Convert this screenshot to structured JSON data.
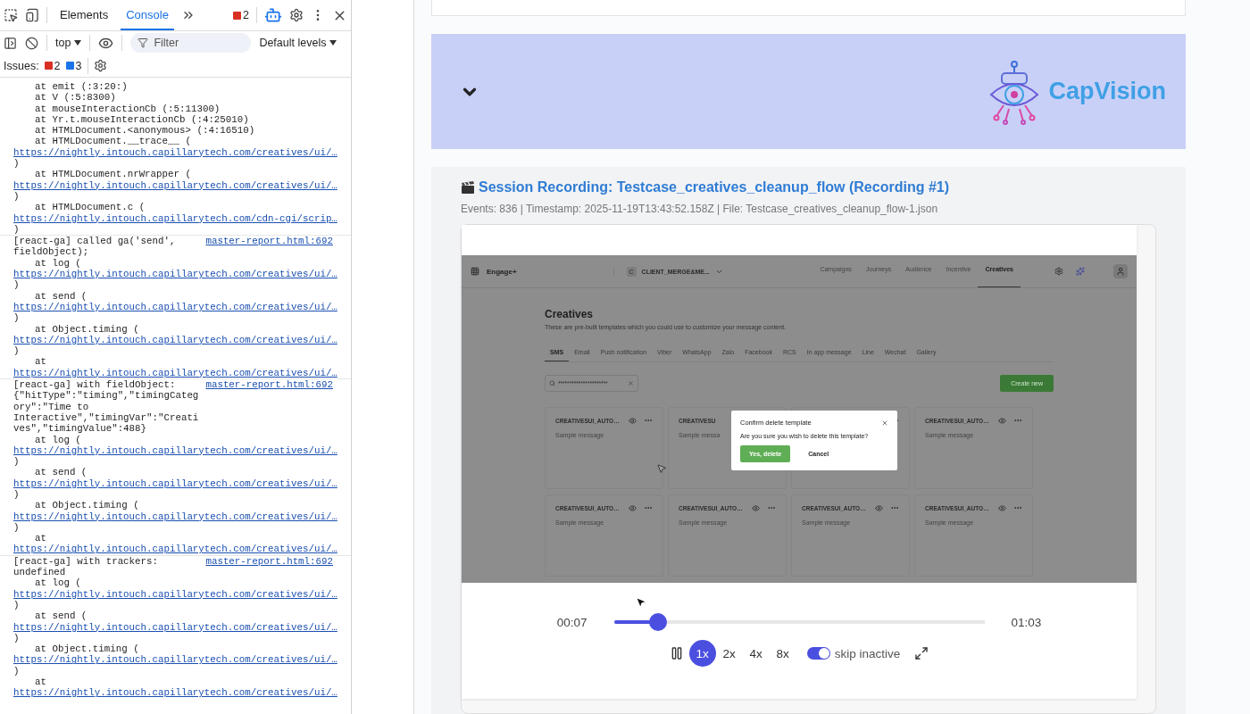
{
  "devtools": {
    "tabs": [
      {
        "label": "Elements",
        "selected": false
      },
      {
        "label": "Console",
        "selected": true
      }
    ],
    "error_count": "2",
    "context": "top",
    "filter_placeholder": "Filter",
    "levels": "Default levels",
    "issues_label": "Issues:",
    "issues": [
      {
        "kind": "error",
        "count": "2"
      },
      {
        "kind": "info",
        "count": "3"
      }
    ],
    "log": [
      {
        "lines": [
          {
            "kind": "frame",
            "text": "at emit (:3:20:)"
          },
          {
            "kind": "frame",
            "text": "at V (:5:8300)"
          },
          {
            "kind": "frame",
            "text": "at mouseInteractionCb (:5:11300)"
          },
          {
            "kind": "frame",
            "text": "at Yr.t.mouseInteractionCb (:4:25010)"
          },
          {
            "kind": "frame",
            "text": "at HTMLDocument.<anonymous> (:4:16510)"
          },
          {
            "kind": "frame",
            "text": "at HTMLDocument.__trace__ ("
          },
          {
            "kind": "url",
            "text": "https://nightly.intouch.capillarytech.com/creatives/ui/…"
          },
          {
            "kind": "close",
            "text": ")"
          },
          {
            "kind": "frame",
            "text": "at HTMLDocument.nrWrapper ("
          },
          {
            "kind": "url",
            "text": "https://nightly.intouch.capillarytech.com/creatives/ui/…"
          },
          {
            "kind": "close",
            "text": ")"
          },
          {
            "kind": "frame",
            "text": "at HTMLDocument.c ("
          },
          {
            "kind": "url",
            "text": "https://nightly.intouch.capillarytech.com/cdn-cgi/scrip…"
          },
          {
            "kind": "close",
            "text": ")"
          }
        ]
      },
      {
        "message": "[react-ga] called ga('send', fieldObject);",
        "source": "master-report.html:692",
        "lines": [
          {
            "kind": "frame",
            "text": "at log ("
          },
          {
            "kind": "url",
            "text": "https://nightly.intouch.capillarytech.com/creatives/ui/…"
          },
          {
            "kind": "close",
            "text": ")"
          },
          {
            "kind": "frame",
            "text": "at send ("
          },
          {
            "kind": "url",
            "text": "https://nightly.intouch.capillarytech.com/creatives/ui/…"
          },
          {
            "kind": "close",
            "text": ")"
          },
          {
            "kind": "frame",
            "text": "at Object.timing ("
          },
          {
            "kind": "url",
            "text": "https://nightly.intouch.capillarytech.com/creatives/ui/…"
          },
          {
            "kind": "close",
            "text": ")"
          },
          {
            "kind": "frame",
            "text": "at"
          },
          {
            "kind": "url",
            "text": "https://nightly.intouch.capillarytech.com/creatives/ui/…"
          }
        ]
      },
      {
        "message": "[react-ga] with fieldObject: {\"hitType\":\"timing\",\"timingCategory\":\"Time to Interactive\",\"timingVar\":\"Creatives\",\"timingValue\":488}",
        "source": "master-report.html:692",
        "lines": [
          {
            "kind": "frame",
            "text": "at log ("
          },
          {
            "kind": "url",
            "text": "https://nightly.intouch.capillarytech.com/creatives/ui/…"
          },
          {
            "kind": "close",
            "text": ")"
          },
          {
            "kind": "frame",
            "text": "at send ("
          },
          {
            "kind": "url",
            "text": "https://nightly.intouch.capillarytech.com/creatives/ui/…"
          },
          {
            "kind": "close",
            "text": ")"
          },
          {
            "kind": "frame",
            "text": "at Object.timing ("
          },
          {
            "kind": "url",
            "text": "https://nightly.intouch.capillarytech.com/creatives/ui/…"
          },
          {
            "kind": "close",
            "text": ")"
          },
          {
            "kind": "frame",
            "text": "at"
          },
          {
            "kind": "url",
            "text": "https://nightly.intouch.capillarytech.com/creatives/ui/…"
          }
        ]
      },
      {
        "message": "[react-ga] with trackers: undefined",
        "source": "master-report.html:692",
        "lines": [
          {
            "kind": "frame",
            "text": "at log ("
          },
          {
            "kind": "url",
            "text": "https://nightly.intouch.capillarytech.com/creatives/ui/…"
          },
          {
            "kind": "close",
            "text": ")"
          },
          {
            "kind": "frame",
            "text": "at send ("
          },
          {
            "kind": "url",
            "text": "https://nightly.intouch.capillarytech.com/creatives/ui/…"
          },
          {
            "kind": "close",
            "text": ")"
          },
          {
            "kind": "frame",
            "text": "at Object.timing ("
          },
          {
            "kind": "url",
            "text": "https://nightly.intouch.capillarytech.com/creatives/ui/…"
          },
          {
            "kind": "close",
            "text": ")"
          },
          {
            "kind": "frame",
            "text": "at"
          },
          {
            "kind": "url",
            "text": "https://nightly.intouch.capillarytech.com/creatives/ui/…"
          }
        ]
      }
    ]
  },
  "banner": {
    "logo_text": "CapVision"
  },
  "recording": {
    "title": "Session Recording: Testcase_creatives_cleanup_flow (Recording #1)",
    "meta": "Events: 836 | Timestamp: 2025-11-19T13:43:52.158Z | File: Testcase_creatives_cleanup_flow-1.json",
    "app": {
      "brand": "Engage+",
      "org_initial": "C",
      "org": "CLIENT_MERGE&ME...",
      "nav": [
        {
          "label": "Campaigns",
          "selected": false
        },
        {
          "label": "Journeys",
          "selected": false
        },
        {
          "label": "Audience",
          "selected": false
        },
        {
          "label": "Incentive",
          "selected": false
        },
        {
          "label": "Creatives",
          "selected": true
        }
      ],
      "page_title": "Creatives",
      "page_subtitle": "These are pre-built templates which you could use to customize your message content.",
      "channels": [
        {
          "label": "SMS",
          "selected": true
        },
        {
          "label": "Email",
          "selected": false
        },
        {
          "label": "Push notification",
          "selected": false
        },
        {
          "label": "Viber",
          "selected": false
        },
        {
          "label": "WhatsApp",
          "selected": false
        },
        {
          "label": "Zalo",
          "selected": false
        },
        {
          "label": "Facebook",
          "selected": false
        },
        {
          "label": "RCS",
          "selected": false
        },
        {
          "label": "In app message",
          "selected": false
        },
        {
          "label": "Line",
          "selected": false
        },
        {
          "label": "Wechat",
          "selected": false
        },
        {
          "label": "Gallery",
          "selected": false
        }
      ],
      "search_value": "**********************",
      "create_button": "Create new",
      "cards": [
        {
          "title": "CREATIVESUI_AUTO…",
          "eye": true,
          "menu": true,
          "message": "Sample message"
        },
        {
          "title": "CREATIVESU",
          "eye": false,
          "menu": false,
          "message": "Sample messa"
        },
        {
          "eye": false,
          "menu": true
        },
        {
          "title": "CREATIVESUI_AUTO…",
          "eye": true,
          "menu": true,
          "message": "Sample message"
        },
        {
          "title": "CREATIVESUI_AUTO…",
          "eye": true,
          "menu": true,
          "message": "Sample message"
        },
        {
          "title": "CREATIVESUI_AUTO…",
          "eye": true,
          "menu": true,
          "message": "Sample message"
        },
        {
          "title": "CREATIVESUI_AUTO…",
          "eye": true,
          "menu": true,
          "message": "Sample message"
        },
        {
          "title": "CREATIVESUI_AUTO…",
          "eye": true,
          "menu": true,
          "message": "Sample message"
        }
      ],
      "dialog": {
        "title": "Confirm delete template",
        "text": "Are you sure you wish to delete this template?",
        "confirm": "Yes, delete",
        "cancel": "Cancel"
      }
    },
    "player": {
      "elapsed": "00:07",
      "level": 0.12,
      "duration": "01:03",
      "playing": true,
      "speeds": [
        {
          "label": "1x",
          "selected": true
        },
        {
          "label": "2x",
          "selected": false
        },
        {
          "label": "4x",
          "selected": false
        },
        {
          "label": "8x",
          "selected": false
        }
      ],
      "skip_inactive": {
        "label": "skip inactive",
        "on": true
      }
    }
  }
}
